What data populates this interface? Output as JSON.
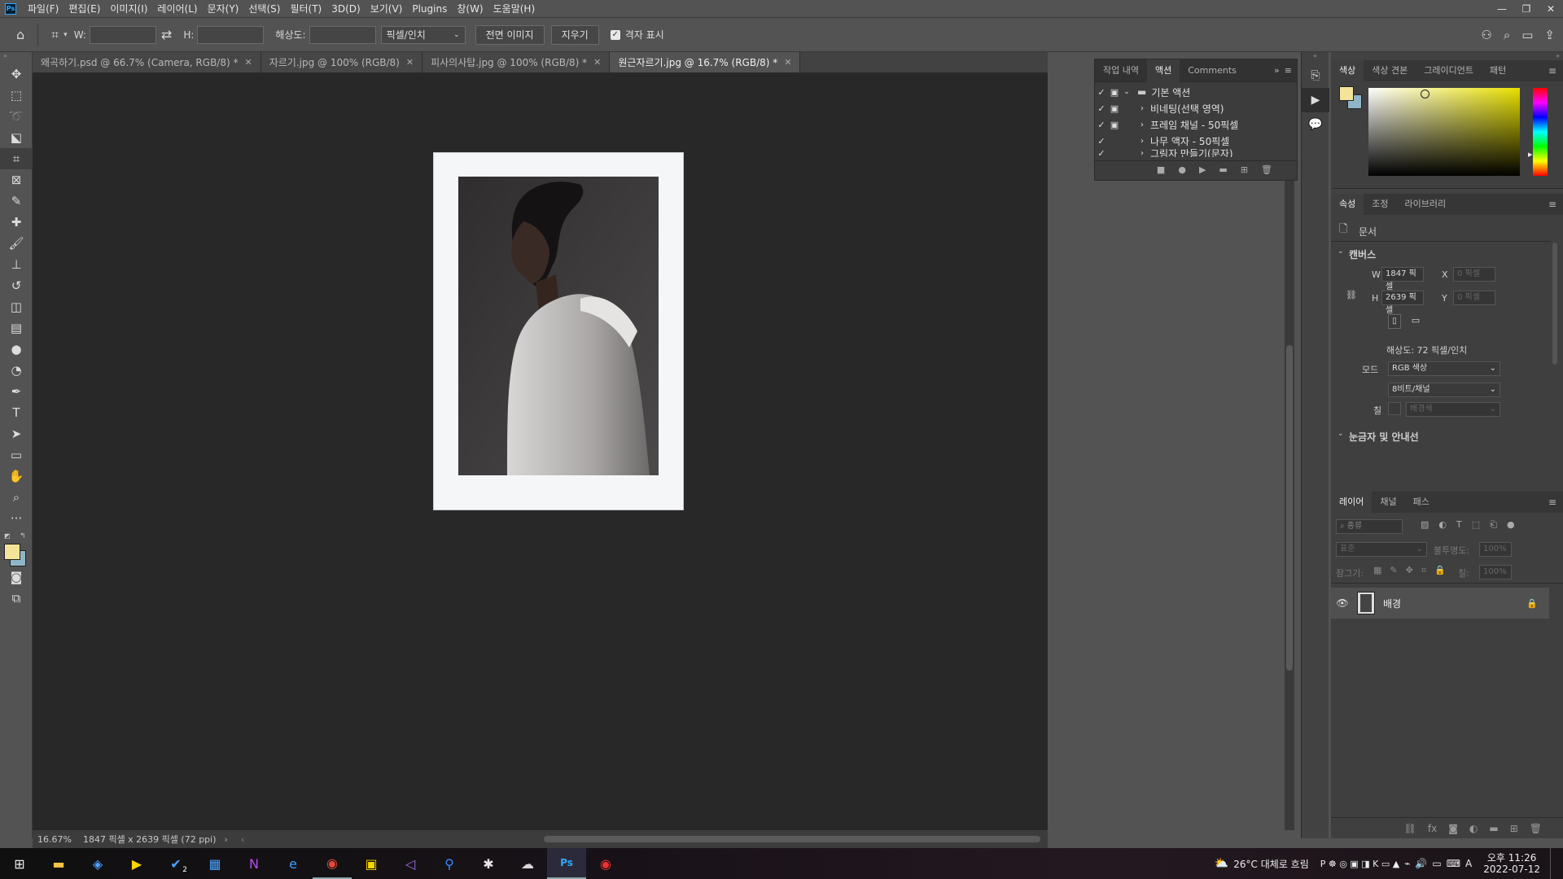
{
  "menu": {
    "logo": "Ps",
    "items": [
      "파일(F)",
      "편집(E)",
      "이미지(I)",
      "레이어(L)",
      "문자(Y)",
      "선택(S)",
      "필터(T)",
      "3D(D)",
      "보기(V)",
      "Plugins",
      "창(W)",
      "도움말(H)"
    ]
  },
  "options": {
    "w_label": "W:",
    "h_label": "H:",
    "resolution_label": "해상도:",
    "unit_select": "픽셀/인치",
    "front_image_btn": "전면 이미지",
    "clear_btn": "지우기",
    "grid_label": "격자 표시"
  },
  "tabs": [
    {
      "label": "왜곡하기.psd @ 66.7% (Camera, RGB/8) *"
    },
    {
      "label": "자르기.jpg @ 100% (RGB/8)"
    },
    {
      "label": "피사의사탑.jpg @ 100% (RGB/8) *"
    },
    {
      "label": "원근자르기.jpg @ 16.7% (RGB/8) *"
    }
  ],
  "status": {
    "zoom": "16.67%",
    "info": "1847 픽셀 x 2639 픽셀 (72 ppi)"
  },
  "actions_panel": {
    "tabs": [
      "작업 내역",
      "액션",
      "Comments"
    ],
    "rows": [
      {
        "label": "기본 액션"
      },
      {
        "label": "비네팅(선택 영역)"
      },
      {
        "label": "프레임 채널 - 50픽셀"
      },
      {
        "label": "나무 액자 - 50픽셀"
      },
      {
        "label": "그림자 만들기(문자)"
      }
    ]
  },
  "color_panel": {
    "tabs": [
      "색상",
      "색상 견본",
      "그레이디언트",
      "패턴"
    ],
    "fg_color": "#f3e49a",
    "bg_color": "#8fb6c8"
  },
  "properties_panel": {
    "tabs": [
      "속성",
      "조정",
      "라이브러리"
    ],
    "doc_label": "문서",
    "canvas_section": "캔버스",
    "w_label": "W",
    "w_value": "1847 픽셀",
    "h_label": "H",
    "h_value": "2639 픽셀",
    "x_label": "X",
    "x_placeholder": "0 픽셀",
    "y_label": "Y",
    "y_placeholder": "0 픽셀",
    "resolution_text": "해상도: 72 픽셀/인치",
    "mode_label": "모드",
    "mode_value": "RGB 색상",
    "depth_value": "8비트/채널",
    "fill_label": "칠",
    "fill_value": "배경색",
    "rulers_section": "눈금자 및 안내선"
  },
  "layers_panel": {
    "tabs": [
      "레이어",
      "채널",
      "패스"
    ],
    "kind_placeholder": "종류",
    "blend_mode": "표준",
    "opacity_label": "불투명도:",
    "opacity_value": "100%",
    "lock_label": "잠그기:",
    "fill_label": "칠:",
    "fill_value": "100%",
    "layers": [
      {
        "name": "배경"
      }
    ]
  },
  "taskbar": {
    "weather": "26°C 대체로 흐림",
    "time": "오후 11:26",
    "date": "2022-07-12",
    "ime": "A",
    "badge": "2"
  }
}
